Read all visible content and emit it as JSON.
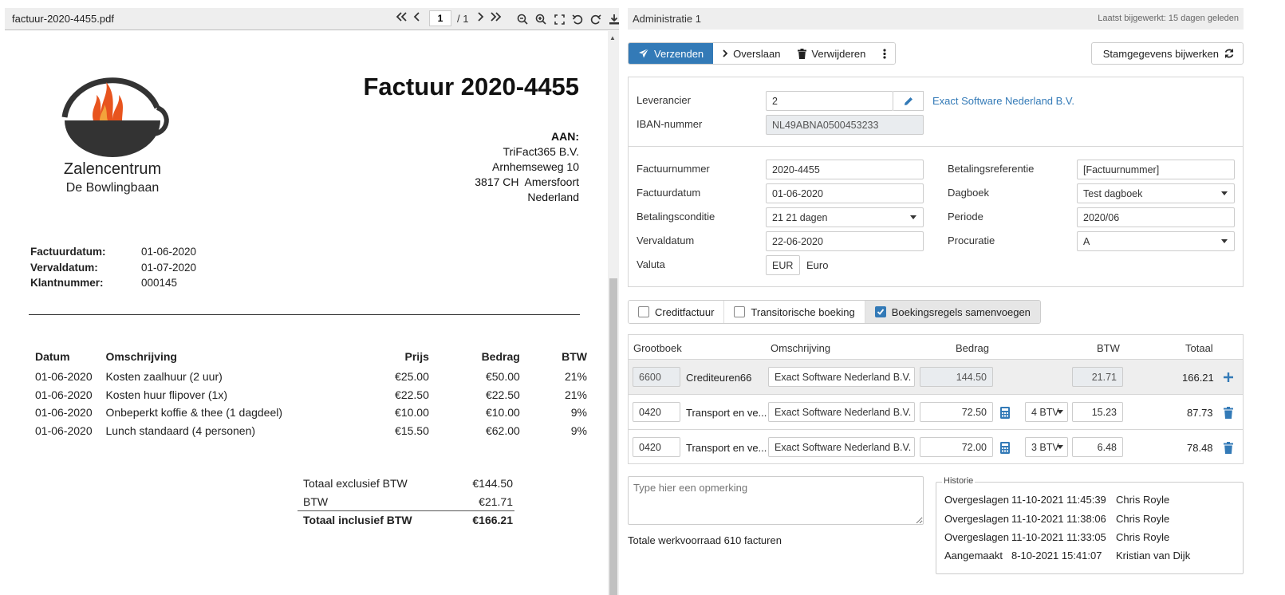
{
  "pdf": {
    "filename": "factuur-2020-4455.pdf",
    "page_current": "1",
    "page_total": "/ 1",
    "logo": {
      "line1": "Zalencentrum",
      "line2": "De Bowlingbaan"
    },
    "title": "Factuur 2020-4455",
    "to": {
      "label": "AAN:",
      "lines": [
        "TriFact365 B.V.",
        "Arnhemseweg 10",
        "3817 CH  Amersfoort",
        "Nederland"
      ]
    },
    "meta": [
      {
        "k": "Factuurdatum:",
        "v": "01-06-2020"
      },
      {
        "k": "Vervaldatum:",
        "v": "01-07-2020"
      },
      {
        "k": "Klantnummer:",
        "v": "000145"
      }
    ],
    "items_header": [
      "Datum",
      "Omschrijving",
      "Prijs",
      "Bedrag",
      "BTW"
    ],
    "items": [
      [
        "01-06-2020",
        "Kosten zaalhuur (2 uur)",
        "€25.00",
        "€50.00",
        "21%"
      ],
      [
        "01-06-2020",
        "Kosten huur flipover (1x)",
        "€22.50",
        "€22.50",
        "21%"
      ],
      [
        "01-06-2020",
        "Onbeperkt koffie & thee (1 dagdeel)",
        "€10.00",
        "€10.00",
        "9%"
      ],
      [
        "01-06-2020",
        "Lunch standaard (4 personen)",
        "€15.50",
        "€62.00",
        "9%"
      ]
    ],
    "totals": [
      {
        "k": "Totaal exclusief BTW",
        "v": "€144.50"
      },
      {
        "k": "BTW",
        "v": "€21.71"
      },
      {
        "k": "Totaal inclusief BTW",
        "v": "€166.21"
      }
    ]
  },
  "admin": {
    "title": "Administratie 1",
    "updated": "Laatst bijgewerkt: 15 dagen geleden",
    "actions": {
      "send": "Verzenden",
      "skip": "Overslaan",
      "delete": "Verwijderen",
      "stam": "Stamgegevens bijwerken"
    },
    "supplier": {
      "label": "Leverancier",
      "value": "2",
      "name": "Exact Software Nederland B.V.",
      "iban_label": "IBAN-nummer",
      "iban": "NL49ABNA0500453233"
    },
    "form": {
      "factuurnummer_label": "Factuurnummer",
      "factuurnummer": "2020-4455",
      "factuurdatum_label": "Factuurdatum",
      "factuurdatum": "01-06-2020",
      "betalingsconditie_label": "Betalingsconditie",
      "betalingsconditie": "21 21 dagen",
      "vervaldatum_label": "Vervaldatum",
      "vervaldatum": "22-06-2020",
      "valuta_label": "Valuta",
      "valuta_code": "EUR",
      "valuta_name": "Euro",
      "betalingsreferentie_label": "Betalingsreferentie",
      "betalingsreferentie": "[Factuurnummer]",
      "dagboek_label": "Dagboek",
      "dagboek": "Test dagboek",
      "periode_label": "Periode",
      "periode": "2020/06",
      "procuratie_label": "Procuratie",
      "procuratie": "A"
    },
    "options": [
      {
        "label": "Creditfactuur",
        "checked": false
      },
      {
        "label": "Transitorische boeking",
        "checked": false
      },
      {
        "label": "Boekingsregels samenvoegen",
        "checked": true
      }
    ],
    "lines_header": {
      "grootboek": "Grootboek",
      "omschrijving": "Omschrijving",
      "bedrag": "Bedrag",
      "btw": "BTW",
      "totaal": "Totaal"
    },
    "lines": [
      {
        "code": "6600",
        "name": "Crediteuren66",
        "desc": "Exact Software Nederland B.V.",
        "bedrag": "144.50",
        "btw_code": "",
        "btw": "21.71",
        "totaal": "166.21"
      },
      {
        "code": "0420",
        "name": "Transport en ve...",
        "desc": "Exact Software Nederland B.V.",
        "bedrag": "72.50",
        "btw_code": "4 BTV",
        "btw": "15.23",
        "totaal": "87.73"
      },
      {
        "code": "0420",
        "name": "Transport en ve...",
        "desc": "Exact Software Nederland B.V.",
        "bedrag": "72.00",
        "btw_code": "3 BTV",
        "btw": "6.48",
        "totaal": "78.48"
      }
    ],
    "remark_placeholder": "Type hier een opmerking",
    "werkvoorraad": "Totale werkvoorraad 610 facturen",
    "history": {
      "legend": "Historie",
      "rows": [
        {
          "action": "Overgeslagen",
          "time": "11-10-2021 11:45:39",
          "user": "Chris Royle"
        },
        {
          "action": "Overgeslagen",
          "time": "11-10-2021 11:38:06",
          "user": "Chris Royle"
        },
        {
          "action": "Overgeslagen",
          "time": "11-10-2021 11:33:05",
          "user": "Chris Royle"
        },
        {
          "action": "Aangemaakt",
          "time": "8-10-2021 15:41:07",
          "user": "Kristian van Dijk"
        }
      ]
    }
  },
  "colors": {
    "primary": "#337ab7",
    "panel_bg": "#eeeeee",
    "logo_orange": "#e8541e"
  }
}
